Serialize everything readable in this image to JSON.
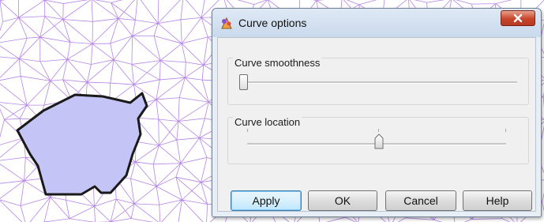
{
  "dialog": {
    "title": "Curve options",
    "groups": {
      "smoothness": {
        "label": "Curve smoothness",
        "value_fraction": 0.0
      },
      "location": {
        "label": "Curve location",
        "value_fraction": 0.5
      }
    },
    "buttons": {
      "apply": "Apply",
      "ok": "OK",
      "cancel": "Cancel",
      "help": "Help"
    }
  },
  "background": {
    "mesh_color": "#b585e6",
    "region_fill": "#c4c4f7",
    "region_outline": "#1a1a1a"
  }
}
